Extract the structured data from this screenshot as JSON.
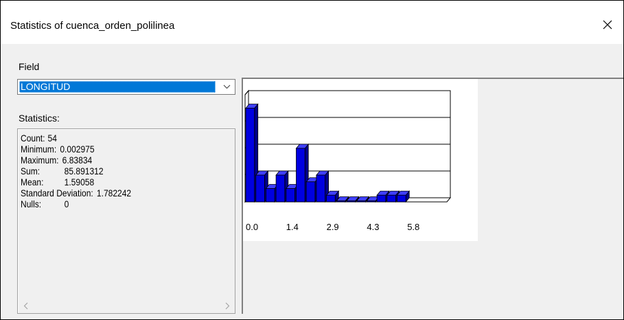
{
  "window": {
    "title": "Statistics of cuenca_orden_polilinea",
    "close_icon": "close-icon"
  },
  "field": {
    "label": "Field",
    "selected": "LONGITUD"
  },
  "statistics": {
    "label": "Statistics:",
    "rows": [
      {
        "label": "Count:",
        "value": "54"
      },
      {
        "label": "Minimum:",
        "value": "0.002975"
      },
      {
        "label": "Maximum:",
        "value": "6.83834"
      },
      {
        "label": "Sum:",
        "value": "85.891312"
      },
      {
        "label": "Mean:",
        "value": "1.59058"
      },
      {
        "label": "Standard Deviation:",
        "value": "1.782242"
      },
      {
        "label": "Nulls:",
        "value": "0"
      }
    ]
  },
  "chart_data": {
    "type": "bar",
    "title": "",
    "xlabel": "",
    "ylabel": "",
    "tick_labels": [
      "0.0",
      "1.4",
      "2.9",
      "4.3",
      "5.8"
    ],
    "bin_count": 20,
    "values": [
      14,
      4,
      2,
      4,
      2,
      8,
      3,
      4,
      1,
      0,
      0,
      0,
      0,
      1,
      1,
      1
    ],
    "bar_color": "#0000e0",
    "ylim": [
      0,
      16
    ],
    "grid": true
  }
}
